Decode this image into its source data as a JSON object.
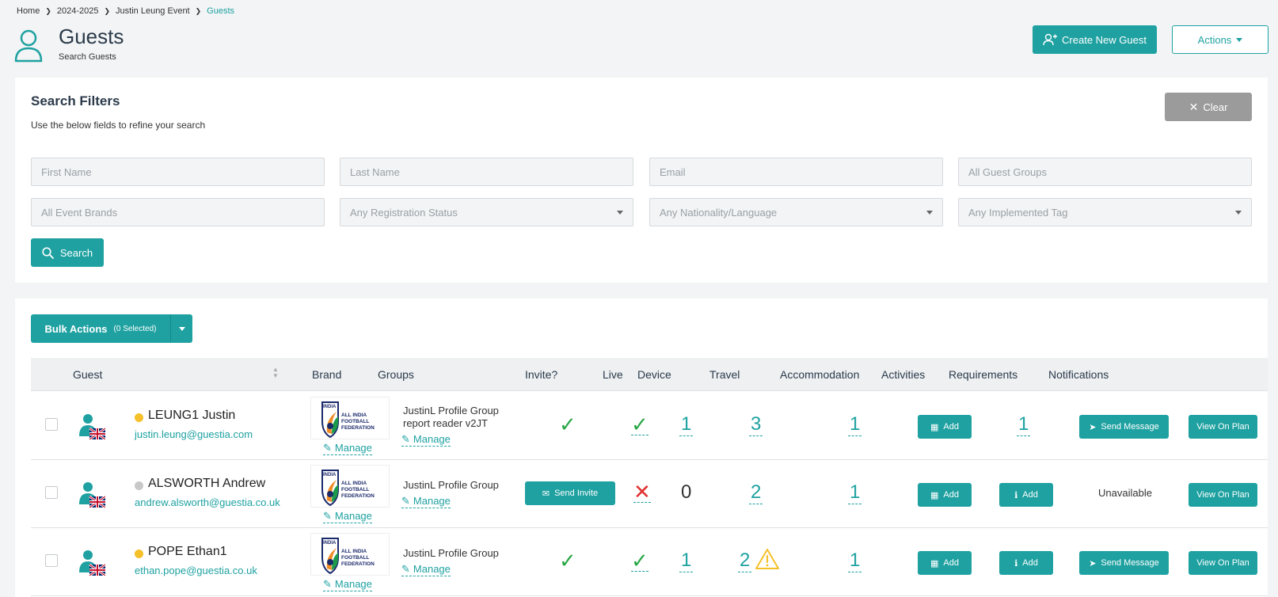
{
  "breadcrumb": {
    "home": "Home",
    "season": "2024-2025",
    "event": "Justin Leung Event",
    "current": "Guests"
  },
  "header": {
    "title": "Guests",
    "subtitle": "Search Guests",
    "create_label": "Create New Guest",
    "actions_label": "Actions"
  },
  "filters": {
    "title": "Search Filters",
    "description": "Use the below fields to refine your search",
    "clear_label": "Clear",
    "first_name_placeholder": "First Name",
    "last_name_placeholder": "Last Name",
    "email_placeholder": "Email",
    "guest_groups_placeholder": "All Guest Groups",
    "event_brands_placeholder": "All Event Brands",
    "registration_status": "Any Registration Status",
    "nationality": "Any Nationality/Language",
    "implemented_tag": "Any Implemented Tag",
    "search_label": "Search"
  },
  "bulk": {
    "label": "Bulk Actions",
    "selected": "(0 Selected)"
  },
  "table": {
    "headers": {
      "guest": "Guest",
      "brand": "Brand",
      "groups": "Groups",
      "invite": "Invite?",
      "live": "Live",
      "device": "Device",
      "travel": "Travel",
      "accommodation": "Accommodation",
      "activities": "Activities",
      "requirements": "Requirements",
      "notifications": "Notifications"
    },
    "rows": [
      {
        "status_color": "#f5c02a",
        "name": "LEUNG1 Justin",
        "email": "justin.leung@guestia.com",
        "brand_manage": "Manage",
        "group_line1": "JustinL Profile Group",
        "group_line2": "report reader v2JT",
        "group_manage": "Manage",
        "invite": "check",
        "live": "check",
        "device": "1",
        "travel": "3",
        "accommodation": "1",
        "activities_label": "Add",
        "requirements": "1",
        "notification_label": "Send Message",
        "plan_label": "View On Plan"
      },
      {
        "status_color": "#c8c8c8",
        "name": "ALSWORTH Andrew",
        "email": "andrew.alsworth@guestia.co.uk",
        "brand_manage": "Manage",
        "group_line1": "JustinL Profile Group",
        "group_manage": "Manage",
        "invite_label": "Send Invite",
        "live": "cross",
        "device": "0",
        "travel": "2",
        "accommodation": "1",
        "activities_label": "Add",
        "requirements_label": "Add",
        "notification_text": "Unavailable",
        "plan_label": "View On Plan"
      },
      {
        "status_color": "#f5c02a",
        "name": "POPE Ethan1",
        "email": "ethan.pope@guestia.co.uk",
        "brand_manage": "Manage",
        "group_line1": "JustinL Profile Group",
        "group_manage": "Manage",
        "invite": "check",
        "live": "check",
        "device": "1",
        "travel": "2",
        "accommodation": "1",
        "activities_label": "Add",
        "requirements_label": "Add",
        "notification_label": "Send Message",
        "plan_label": "View On Plan"
      }
    ]
  },
  "brand_logo": {
    "line1": "INDIA",
    "line2": "ALL INDIA",
    "line3": "FOOTBALL",
    "line4": "FEDERATION"
  },
  "colors": {
    "accent": "#1fa1a1",
    "check": "#28a745",
    "cross": "#e03030",
    "warning": "#f5c02a"
  }
}
